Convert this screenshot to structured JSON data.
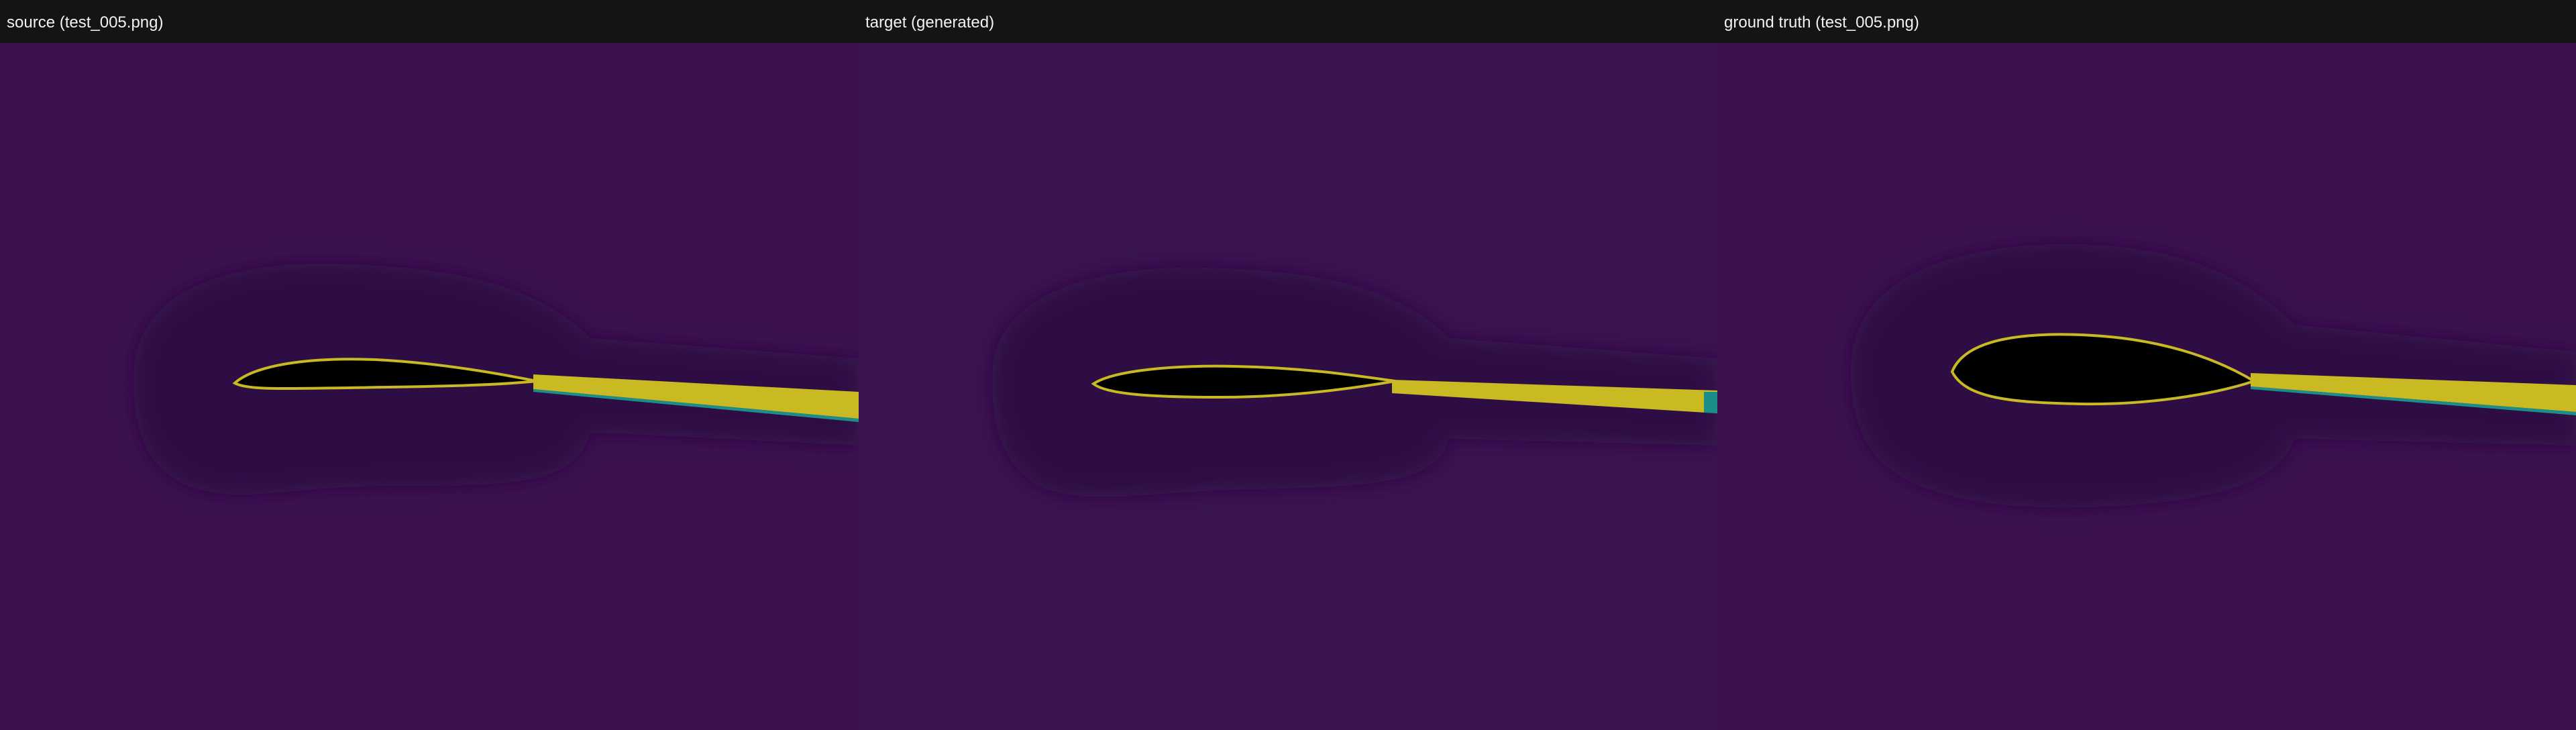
{
  "panels": [
    {
      "title": "source (test_005.png)",
      "colors": {
        "background": "#3b124f",
        "wake": "#2f0a45",
        "airfoil": "#000000",
        "contour": "#c9b923",
        "wake_edge": "#1c8e8a"
      }
    },
    {
      "title": "target (generated)",
      "colors": {
        "background": "#3a1450",
        "wake": "#2f0a45",
        "airfoil": "#000000",
        "contour": "#c9b923",
        "wake_edge": "#1c8e8a"
      }
    },
    {
      "title": "ground truth (test_005.png)",
      "colors": {
        "background": "#3b124f",
        "wake": "#2f0a45",
        "airfoil": "#000000",
        "contour": "#c9b923",
        "wake_edge": "#1c8e8a"
      }
    }
  ]
}
